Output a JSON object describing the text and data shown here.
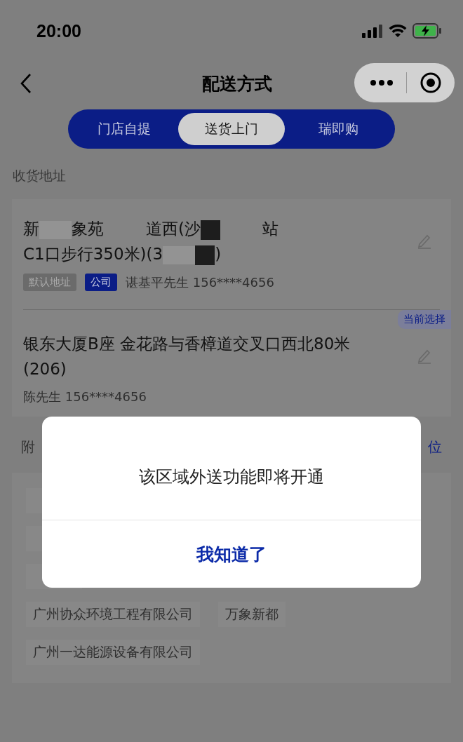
{
  "status_bar": {
    "time": "20:00"
  },
  "nav": {
    "title": "配送方式"
  },
  "tabs": [
    {
      "label": "门店自提",
      "selected": false
    },
    {
      "label": "送货上门",
      "selected": true
    },
    {
      "label": "瑞即购",
      "selected": false
    }
  ],
  "section_title": "收货地址",
  "addresses": [
    {
      "segments": [
        {
          "kind": "text",
          "text": "新"
        },
        {
          "kind": "blur"
        },
        {
          "kind": "text",
          "text": "象苑"
        },
        {
          "kind": "gap"
        },
        {
          "kind": "text",
          "text": "道西(沙"
        },
        {
          "kind": "block"
        },
        {
          "kind": "gap"
        },
        {
          "kind": "text",
          "text": "站"
        },
        {
          "kind": "break"
        },
        {
          "kind": "text",
          "text": "C1口步行350米)(3"
        },
        {
          "kind": "blur"
        },
        {
          "kind": "block"
        },
        {
          "kind": "text",
          "text": ")"
        }
      ],
      "tags": [
        {
          "label": "默认地址",
          "kind": "default"
        },
        {
          "label": "公司",
          "kind": "company"
        }
      ],
      "contact": "谌基平先生 156****4656"
    },
    {
      "segments": [
        {
          "kind": "text",
          "text": "银东大厦B座 金花路与香樟道交叉口西北80米(206)"
        }
      ],
      "badge": "当前选择",
      "contact": "陈先生 156****4656"
    }
  ],
  "nearby": {
    "title": "附",
    "action": "位",
    "rows": [
      [
        {
          "kind": "covered"
        }
      ],
      [
        {
          "kind": "covered"
        }
      ],
      [
        {
          "kind": "covered"
        }
      ],
      [
        {
          "kind": "place",
          "text": "广州协众环境工程有限公司"
        },
        {
          "kind": "place",
          "text": "万象新都"
        }
      ],
      [
        {
          "kind": "place",
          "text": "广州一达能源设备有限公司"
        }
      ]
    ]
  },
  "dialog": {
    "message": "该区域外送功能即将开通",
    "button": "我知道了"
  }
}
